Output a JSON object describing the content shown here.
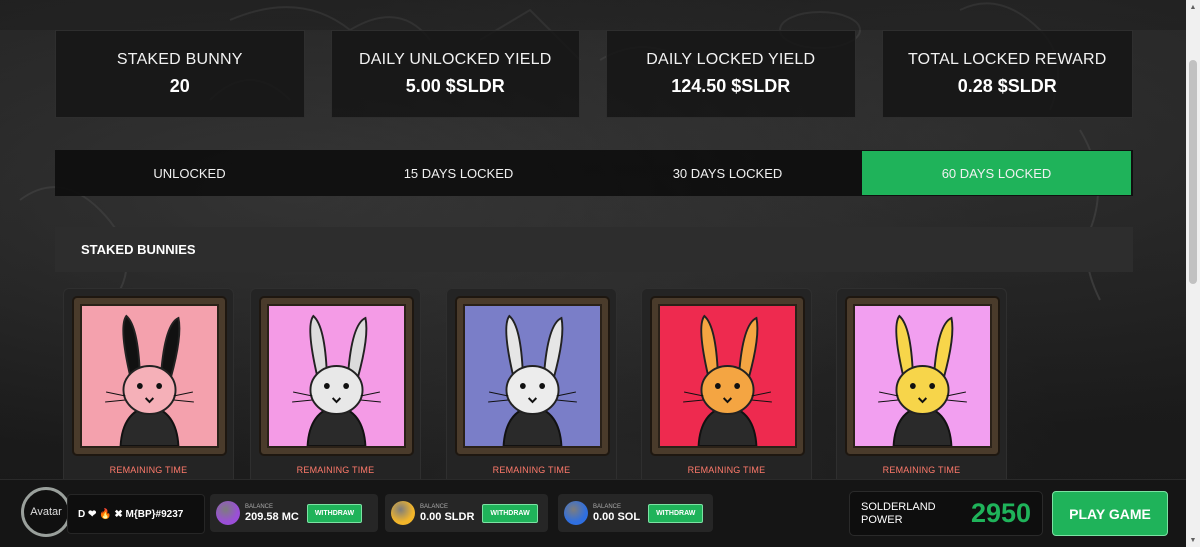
{
  "stats": [
    {
      "label": "STAKED BUNNY",
      "value": "20"
    },
    {
      "label": "DAILY UNLOCKED YIELD",
      "value": "5.00 $SLDR"
    },
    {
      "label": "DAILY LOCKED YIELD",
      "value": "124.50 $SLDR"
    },
    {
      "label": "TOTAL LOCKED REWARD",
      "value": "0.28 $SLDR"
    }
  ],
  "tabs": [
    {
      "label": "UNLOCKED",
      "active": false
    },
    {
      "label": "15 DAYS LOCKED",
      "active": false
    },
    {
      "label": "30 DAYS LOCKED",
      "active": false
    },
    {
      "label": "60 DAYS LOCKED",
      "active": true
    }
  ],
  "staked_section": {
    "title": "STAKED BUNNIES"
  },
  "cards": [
    {
      "remaining_label": "REMAINING TIME",
      "bg_color": "#f4a1ad",
      "ear_color": "#111111",
      "face_color": "#f5b0b8"
    },
    {
      "remaining_label": "REMAINING TIME",
      "bg_color": "#f49be6",
      "ear_color": "#dcdcdc",
      "face_color": "#e8e8e8"
    },
    {
      "remaining_label": "REMAINING TIME",
      "bg_color": "#7a7ec8",
      "ear_color": "#e6e6e6",
      "face_color": "#ececec"
    },
    {
      "remaining_label": "REMAINING TIME",
      "bg_color": "#ee2a4f",
      "ear_color": "#f4a542",
      "face_color": "#f4a542"
    },
    {
      "remaining_label": "REMAINING TIME",
      "bg_color": "#f29ff0",
      "ear_color": "#f7d54a",
      "face_color": "#f7d54a"
    }
  ],
  "user": {
    "avatar_alt": "Avatar",
    "name": "D ❤ 🔥 ✖ M{BP}#9237"
  },
  "wallets": [
    {
      "label": "BALANCE",
      "amount": "209.58 MC",
      "button": "WITHDRAW",
      "coin_color": "#9b4fd8",
      "icon": "mc-coin-icon"
    },
    {
      "label": "BALANCE",
      "amount": "0.00 SLDR",
      "button": "WITHDRAW",
      "coin_color": "#f3b62a",
      "icon": "sldr-coin-icon"
    },
    {
      "label": "BALANCE",
      "amount": "0.00 SOL",
      "button": "WITHDRAW",
      "coin_color": "#2f6fe0",
      "icon": "sol-coin-icon"
    }
  ],
  "power": {
    "label": "SOLDERLAND POWER",
    "value": "2950"
  },
  "play_button": "PLAY GAME",
  "accent_color": "#1fb35a"
}
